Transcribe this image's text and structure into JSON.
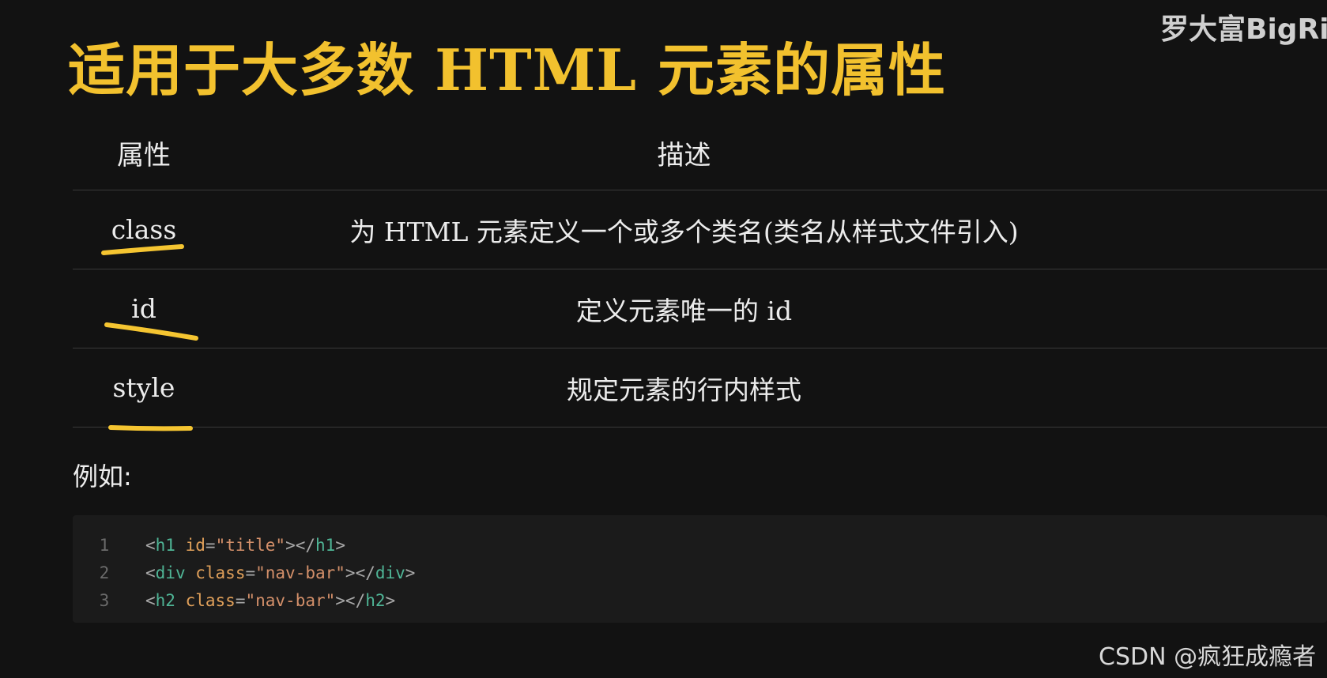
{
  "watermark_top": "罗大富BigRic",
  "title": "适用于大多数 HTML 元素的属性",
  "table": {
    "headers": {
      "attr": "属性",
      "desc": "描述"
    },
    "rows": [
      {
        "attr": "class",
        "desc": "为 HTML 元素定义一个或多个类名(类名从样式文件引入)"
      },
      {
        "attr": "id",
        "desc": "定义元素唯一的 id"
      },
      {
        "attr": "style",
        "desc": "规定元素的行内样式"
      }
    ]
  },
  "example_label": "例如:",
  "code": {
    "lines": [
      {
        "n": "1",
        "open": "<",
        "tag": "h1",
        "attr": "id",
        "eq": "=",
        "value": "\"title\"",
        "close": "></",
        "tag2": "h1",
        "end": ">"
      },
      {
        "n": "2",
        "open": "<",
        "tag": "div",
        "attr": "class",
        "eq": "=",
        "value": "\"nav-bar\"",
        "close": "></",
        "tag2": "div",
        "end": ">"
      },
      {
        "n": "3",
        "open": "<",
        "tag": "h2",
        "attr": "class",
        "eq": "=",
        "value": "\"nav-bar\"",
        "close": "></",
        "tag2": "h2",
        "end": ">"
      }
    ]
  },
  "watermark_bottom": "CSDN @疯狂成瘾者",
  "colors": {
    "title": "#f2c12e",
    "underline": "#f5c531",
    "background": "#121212"
  }
}
